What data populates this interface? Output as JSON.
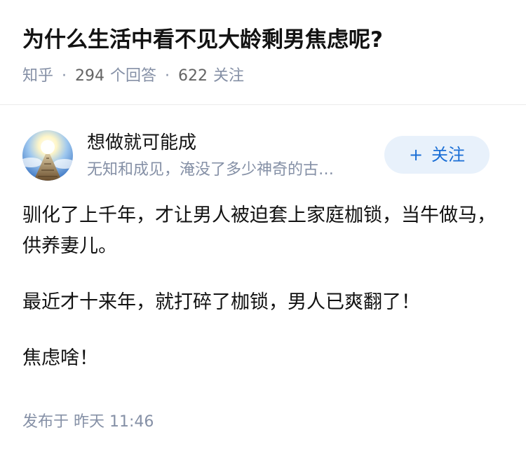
{
  "question": {
    "title": "为什么生活中看不见大龄剩男焦虑呢?",
    "source": "知乎",
    "separator": "·",
    "answer_count": "294",
    "answer_label": "个回答",
    "follower_count": "622",
    "follower_label": "关注"
  },
  "answer": {
    "author": {
      "name": "想做就可能成",
      "bio": "无知和成见，淹没了多少神奇的古…",
      "follow_plus": "+",
      "follow_label": "关注"
    },
    "paragraphs": [
      "驯化了上千年，才让男人被迫套上家庭枷锁，当牛做马，供养妻儿。",
      "最近才十来年，就打碎了枷锁，男人已爽翻了！",
      "焦虑啥！"
    ],
    "publish_label": "发布于",
    "publish_time": "昨天 11:46"
  },
  "colors": {
    "accent": "#1b6fd6",
    "accent_bg": "#e8f1fb",
    "meta_text": "#8590a6"
  }
}
